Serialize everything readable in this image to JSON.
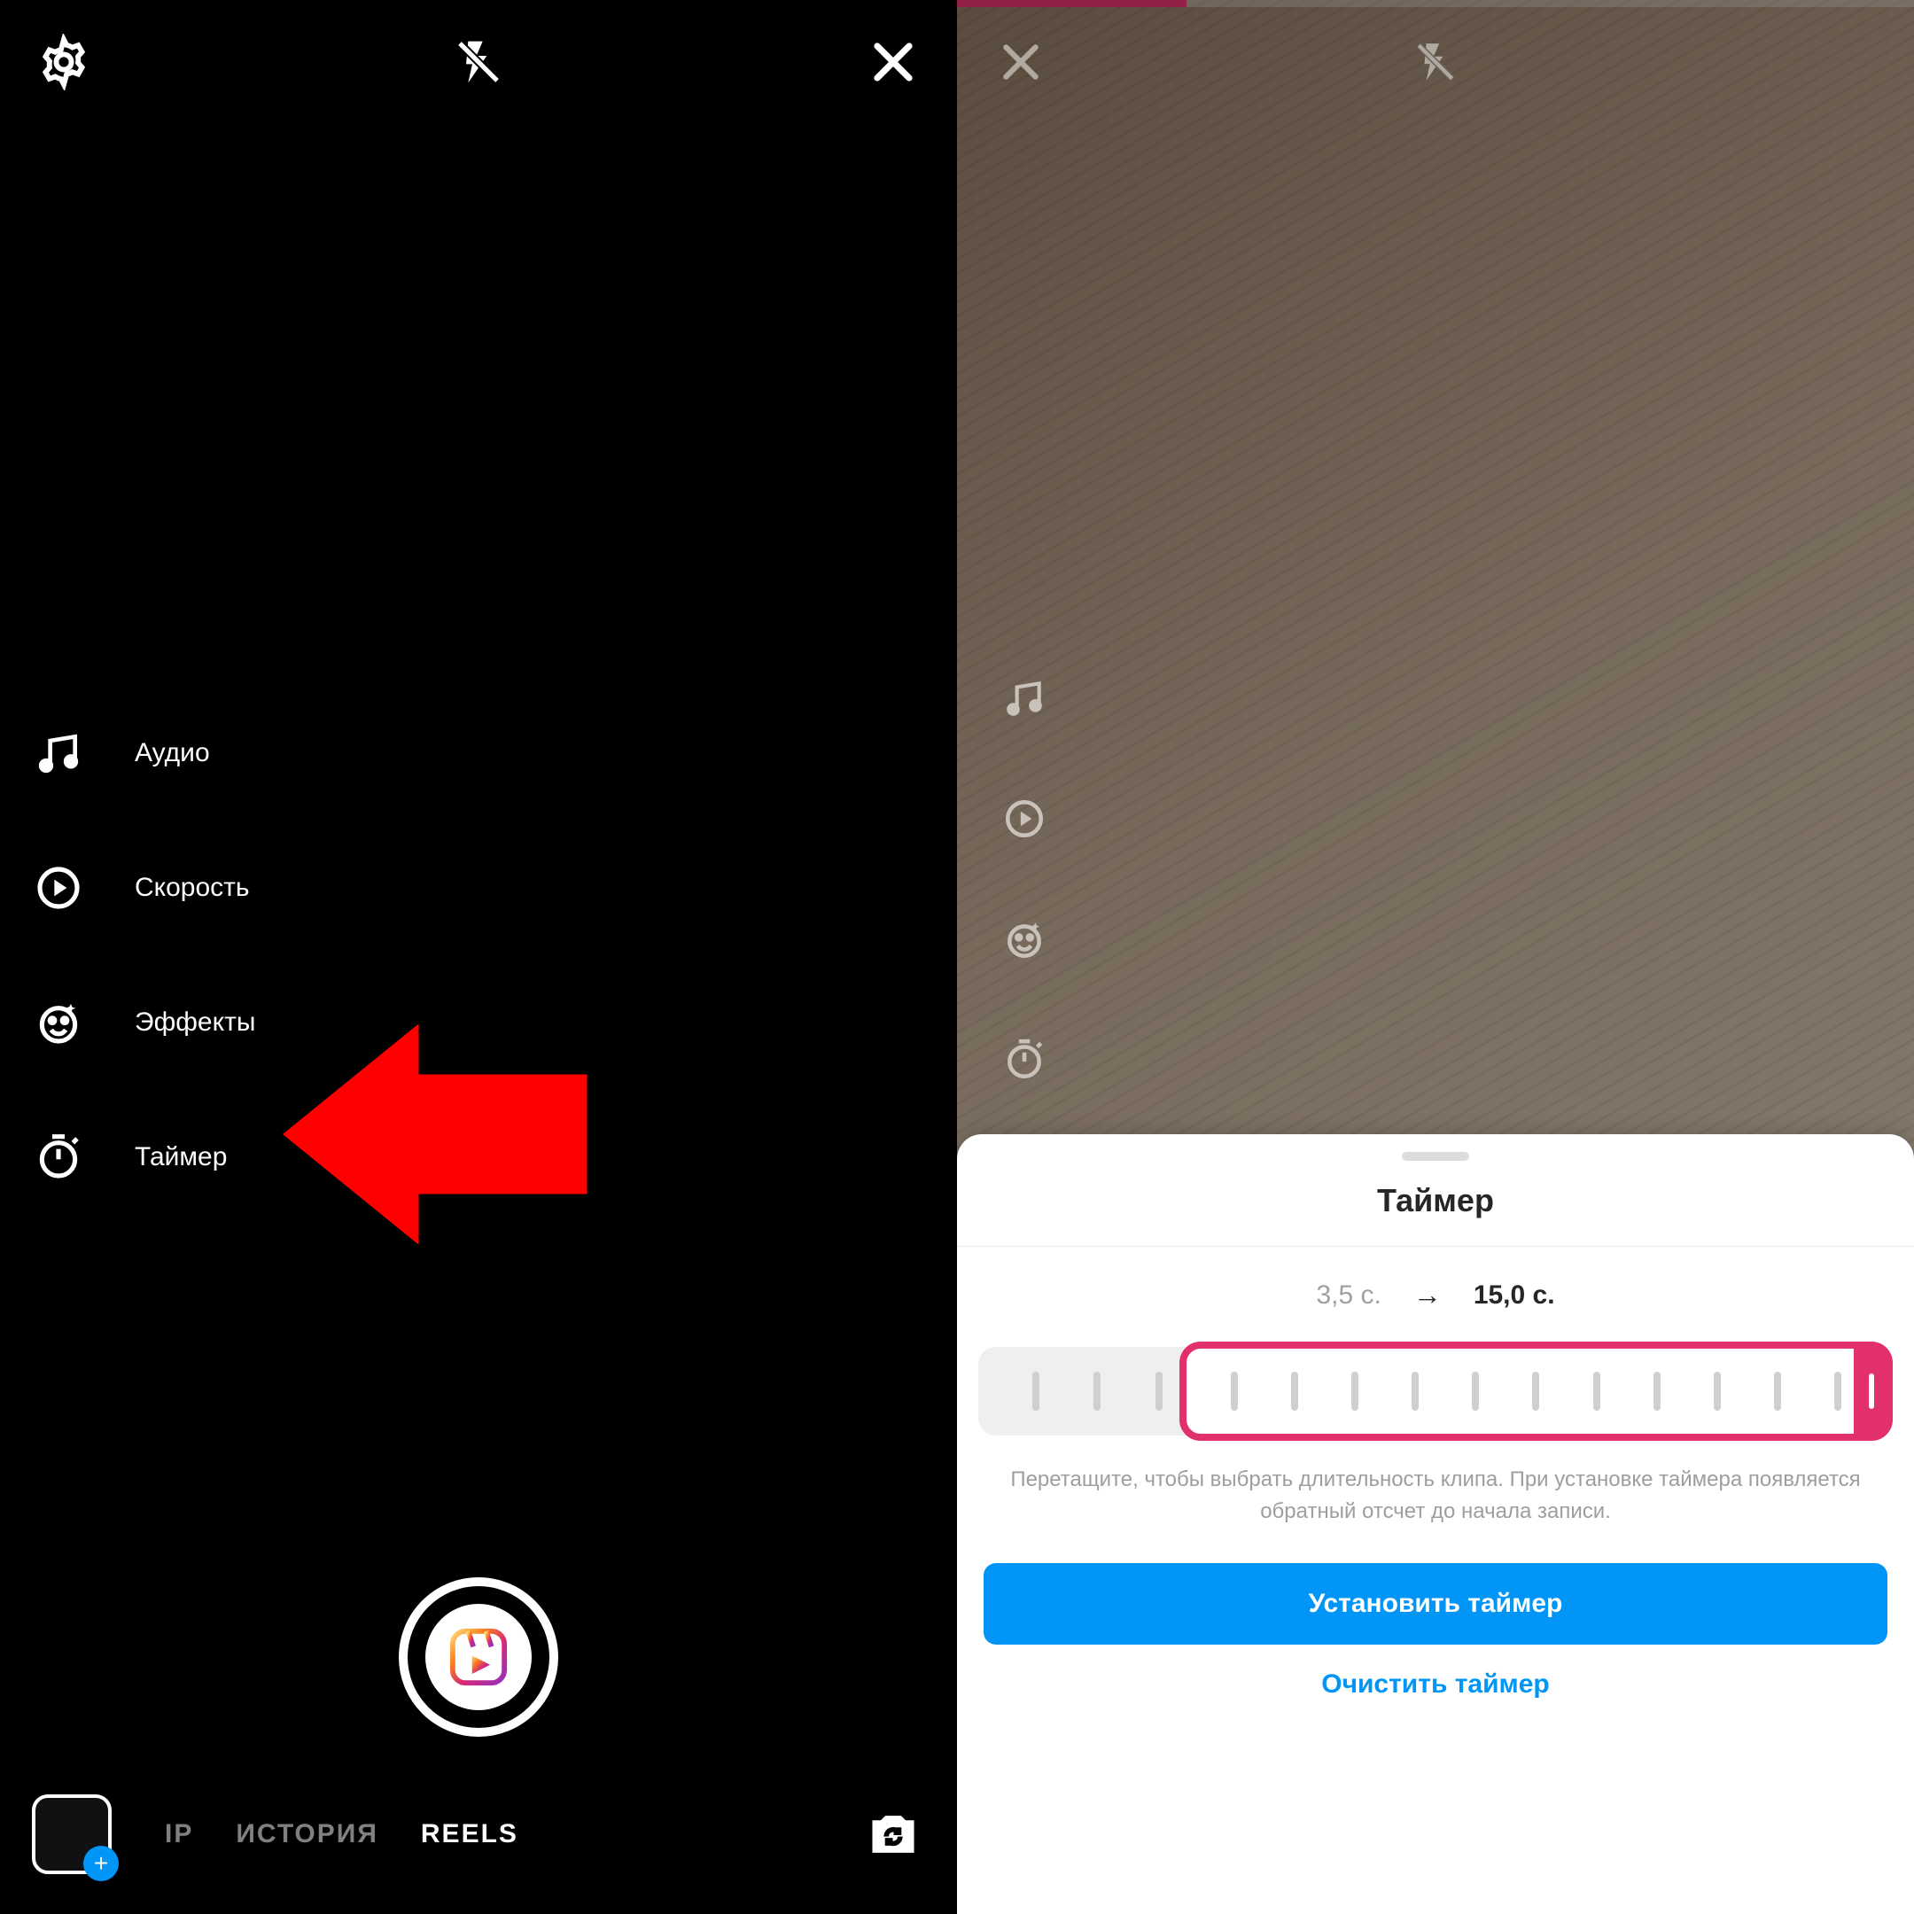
{
  "left": {
    "tools": {
      "audio": "Аудио",
      "speed": "Скорость",
      "effects": "Эффекты",
      "timer": "Таймер"
    },
    "modes": {
      "clip_partial": "ІР",
      "story": "ИСТОРИЯ",
      "reels": "REELS"
    }
  },
  "right": {
    "sheet": {
      "title": "Таймер",
      "time_from": "3,5 с.",
      "time_to": "15,0 с.",
      "help": "Перетащите, чтобы выбрать длительность клипа. При установке таймера появляется обратный отсчет до начала записи.",
      "set_button": "Установить таймер",
      "clear_link": "Очистить таймер"
    }
  }
}
